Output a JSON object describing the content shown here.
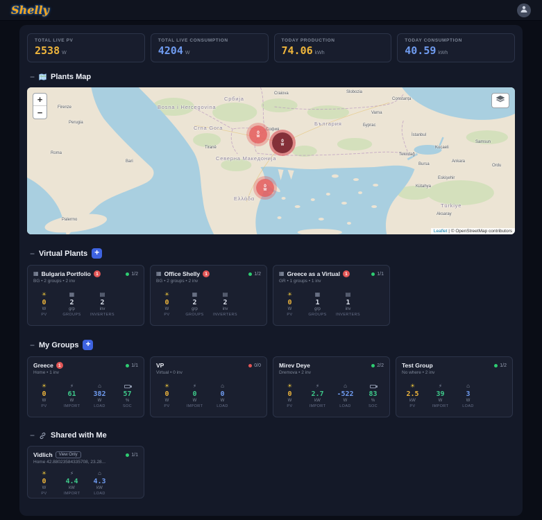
{
  "colors": {
    "pv_accent": "#eeb53c",
    "consumption_accent": "#6f9bef",
    "import_accent": "#3ec98a",
    "status_ok": "#2ecc71",
    "status_alert": "#e25555",
    "add_button_accent": "#3e63e0"
  },
  "icons": {
    "navbar_user": "user-icon",
    "section_map": "map-icon",
    "section_shared": "link-icon",
    "map_layers": "layers-icon",
    "metric_icons": [
      "sun-icon",
      "import-icon",
      "home-icon",
      "battery-icon",
      "groups-icon",
      "inverter-icon"
    ],
    "card_building": "building-icon"
  },
  "navbar": {
    "logo": "Shelly"
  },
  "stats": [
    {
      "label": "TOTAL LIVE PV",
      "value": "2538",
      "unit": "W"
    },
    {
      "label": "TOTAL LIVE CONSUMPTION",
      "value": "4204",
      "unit": "W"
    },
    {
      "label": "TODAY PRODUCTION",
      "value": "74.06",
      "unit": "kWh"
    },
    {
      "label": "TODAY CONSUMPTION",
      "value": "40.59",
      "unit": "kWh"
    }
  ],
  "map_section": {
    "collapse": "−",
    "title": "Plants Map",
    "zoom_in": "+",
    "zoom_out": "−",
    "attribution": {
      "leaflet": "Leaflet",
      "sep": " | ",
      "text": "© OpenStreetMap contributors"
    },
    "markers": [
      {
        "value": "0",
        "unit": "W"
      },
      {
        "value": "0",
        "unit": "W"
      },
      {
        "value": "0",
        "unit": "W"
      }
    ],
    "labels": [
      {
        "text": "Firenze"
      },
      {
        "text": "Perugia"
      },
      {
        "text": "Roma"
      },
      {
        "text": "Bari"
      },
      {
        "text": "Palermo"
      },
      {
        "text": "Craiova"
      },
      {
        "text": "Slobozia"
      },
      {
        "text": "Constanța"
      },
      {
        "text": "Varna"
      },
      {
        "text": "Бургас"
      },
      {
        "text": "София"
      },
      {
        "text": "Tiranë"
      },
      {
        "text": "İstanbul"
      },
      {
        "text": "Tekirdağ"
      },
      {
        "text": "Kocaeli"
      },
      {
        "text": "Bursa"
      },
      {
        "text": "Eskişehir"
      },
      {
        "text": "Ankara"
      },
      {
        "text": "Ordu"
      },
      {
        "text": "Aksaray"
      },
      {
        "text": "Kütahya"
      },
      {
        "text": "Samsun"
      },
      {
        "text": "Србија"
      },
      {
        "text": "Bosna i Hercegovina"
      },
      {
        "text": "Северна Македонија"
      },
      {
        "text": "България"
      },
      {
        "text": "Ελλάδα"
      },
      {
        "text": "Türkiye"
      },
      {
        "text": "Crna Gora"
      }
    ]
  },
  "virtual_plants_section": {
    "collapse": "−",
    "title": "Virtual Plants",
    "add": "+"
  },
  "virtual_plants": [
    {
      "name": "Bulgaria Portfolio",
      "alert": "1",
      "subtitle": "BG • 2 groups • 2 inv",
      "status": "1/2",
      "metrics": [
        {
          "icon": "sun-icon",
          "value": "0",
          "unit": "W",
          "label": "PV"
        },
        {
          "icon": "groups-icon",
          "value": "2",
          "unit": "grp",
          "label": "GROUPS"
        },
        {
          "icon": "inverter-icon",
          "value": "2",
          "unit": "inv",
          "label": "INVERTERS"
        }
      ]
    },
    {
      "name": "Office Shelly",
      "alert": "1",
      "subtitle": "BG • 2 groups • 2 inv",
      "status": "1/2",
      "metrics": [
        {
          "icon": "sun-icon",
          "value": "0",
          "unit": "W",
          "label": "PV"
        },
        {
          "icon": "groups-icon",
          "value": "2",
          "unit": "grp",
          "label": "GROUPS"
        },
        {
          "icon": "inverter-icon",
          "value": "2",
          "unit": "inv",
          "label": "INVERTERS"
        }
      ]
    },
    {
      "name": "Greece as a Virtual",
      "alert": "1",
      "subtitle": "GR • 1 groups • 1 inv",
      "status": "1/1",
      "metrics": [
        {
          "icon": "sun-icon",
          "value": "0",
          "unit": "W",
          "label": "PV"
        },
        {
          "icon": "groups-icon",
          "value": "1",
          "unit": "grp",
          "label": "GROUPS"
        },
        {
          "icon": "inverter-icon",
          "value": "1",
          "unit": "inv",
          "label": "INVERTERS"
        }
      ]
    }
  ],
  "my_groups_section": {
    "collapse": "−",
    "title": "My Groups",
    "add": "+"
  },
  "my_groups": [
    {
      "name": "Greece",
      "alert": "1",
      "subtitle": "Home • 1 inv",
      "status": "1/1",
      "metrics": [
        {
          "icon": "sun-icon",
          "value": "0",
          "unit": "W",
          "label": "PV"
        },
        {
          "icon": "import-icon",
          "value": "61",
          "unit": "W",
          "label": "IMPORT"
        },
        {
          "icon": "home-icon",
          "value": "382",
          "unit": "W",
          "label": "LOAD"
        },
        {
          "icon": "battery-icon",
          "value": "57",
          "unit": "%",
          "label": "SOC"
        }
      ]
    },
    {
      "name": "VP",
      "subtitle": "Virtual • 0 inv",
      "status": "0/0",
      "metrics": [
        {
          "icon": "sun-icon",
          "value": "0",
          "unit": "W",
          "label": "PV"
        },
        {
          "icon": "import-icon",
          "value": "0",
          "unit": "W",
          "label": "IMPORT"
        },
        {
          "icon": "home-icon",
          "value": "0",
          "unit": "W",
          "label": "LOAD"
        }
      ]
    },
    {
      "name": "Mirev Deye",
      "subtitle": "Dremova • 2 inv",
      "status": "2/2",
      "metrics": [
        {
          "icon": "sun-icon",
          "value": "0",
          "unit": "W",
          "label": "PV"
        },
        {
          "icon": "import-icon",
          "value": "2.7",
          "unit": "kW",
          "label": "IMPORT"
        },
        {
          "icon": "home-icon",
          "value": "-522",
          "unit": "W",
          "label": "LOAD"
        },
        {
          "icon": "battery-icon",
          "value": "83",
          "unit": "%",
          "label": "SOC"
        }
      ]
    },
    {
      "name": "Test Group",
      "subtitle": "No where • 2 inv",
      "status": "1/2",
      "metrics": [
        {
          "icon": "sun-icon",
          "value": "2.5",
          "unit": "kW",
          "label": "PV"
        },
        {
          "icon": "import-icon",
          "value": "39",
          "unit": "W",
          "label": "IMPORT"
        },
        {
          "icon": "home-icon",
          "value": "3",
          "unit": "W",
          "label": "LOAD"
        }
      ]
    }
  ],
  "shared_section": {
    "collapse": "−",
    "title": "Shared with Me"
  },
  "shared": [
    {
      "name": "Vidlich",
      "view_badge": "View Only",
      "subtitle": "Home 42.88023584335708, 23.28...",
      "status": "1/1",
      "metrics": [
        {
          "icon": "sun-icon",
          "value": "0",
          "unit": "W",
          "label": "PV"
        },
        {
          "icon": "import-icon",
          "value": "4.4",
          "unit": "kW",
          "label": "IMPORT"
        },
        {
          "icon": "home-icon",
          "value": "4.3",
          "unit": "kW",
          "label": "LOAD"
        }
      ]
    }
  ]
}
